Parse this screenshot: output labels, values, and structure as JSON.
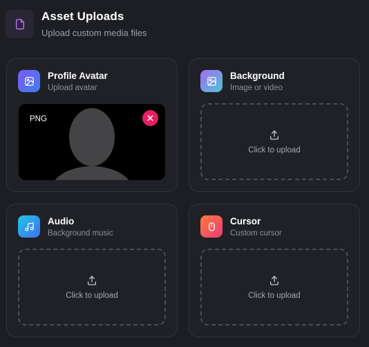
{
  "header": {
    "icon": "file-icon",
    "title": "Asset Uploads",
    "subtitle": "Upload custom media files"
  },
  "cards": {
    "avatar": {
      "icon": "image-icon",
      "title": "Profile Avatar",
      "subtitle": "Upload avatar",
      "preview_type": "PNG",
      "remove_icon": "close-icon"
    },
    "background": {
      "icon": "image-icon",
      "title": "Background",
      "subtitle": "Image or video",
      "upload_label": "Click to upload"
    },
    "audio": {
      "icon": "music-icon",
      "title": "Audio",
      "subtitle": "Background music",
      "upload_label": "Click to upload"
    },
    "cursor": {
      "icon": "mouse-icon",
      "title": "Cursor",
      "subtitle": "Custom cursor",
      "upload_label": "Click to upload"
    }
  },
  "colors": {
    "background": "#1c1e23",
    "card_border": "#31343b",
    "header_icon": "#b06cf0",
    "avatar_gradient": [
      "#7b5cf5",
      "#3f7cf0"
    ],
    "background_gradient": [
      "#a36cf2",
      "#4ec5d4"
    ],
    "audio_gradient": [
      "#1fc6e6",
      "#3f6ff0"
    ],
    "cursor_gradient": [
      "#ff7a3a",
      "#ec3b7a"
    ],
    "remove_button": "#e91e63"
  }
}
